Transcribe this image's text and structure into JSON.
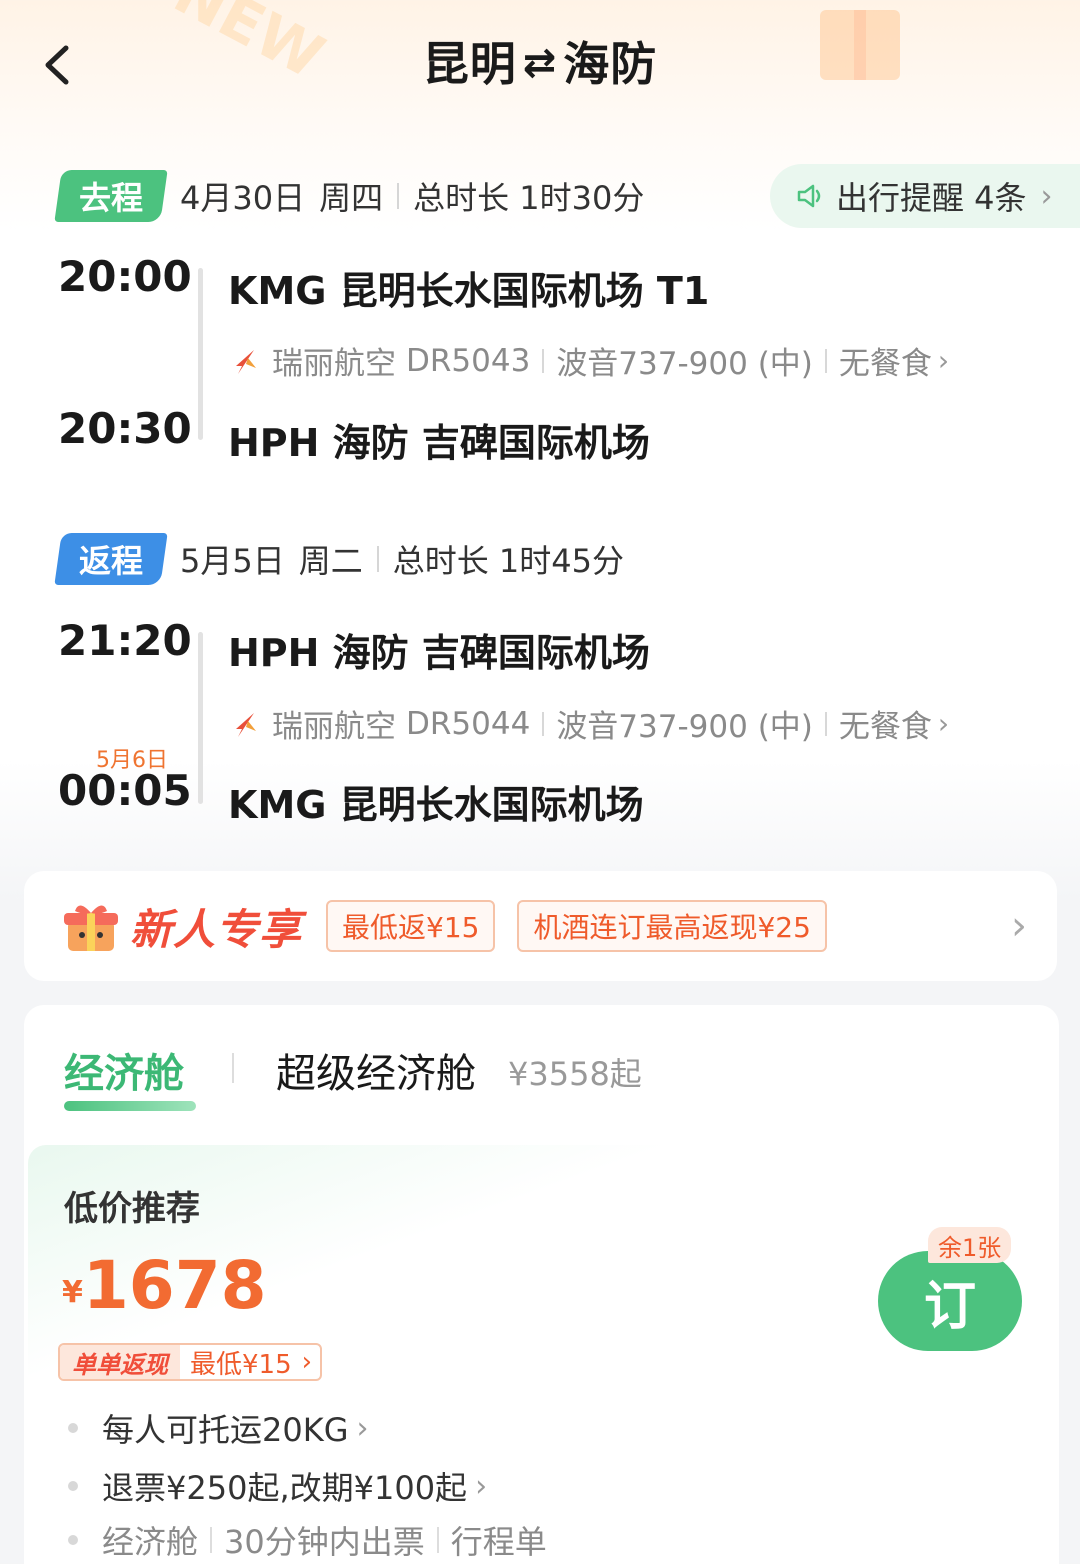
{
  "header": {
    "title_from": "昆明",
    "title_arrows": "⇄",
    "title_to": "海防"
  },
  "outbound": {
    "badge": "去程",
    "date": "4月30日",
    "weekday": "周四",
    "duration": "总时长 1时30分",
    "dep_time": "20:00",
    "dep_airport": "KMG 昆明长水国际机场 T1",
    "airline": "瑞丽航空",
    "flight_no": "DR5043",
    "aircraft": "波音737-900 (中)",
    "meal": "无餐食",
    "arr_time": "20:30",
    "arr_airport": "HPH 海防 吉碑国际机场"
  },
  "reminder": {
    "label": "出行提醒 4条"
  },
  "return": {
    "badge": "返程",
    "date": "5月5日",
    "weekday": "周二",
    "duration": "总时长 1时45分",
    "dep_time": "21:20",
    "dep_airport": "HPH 海防 吉碑国际机场",
    "airline": "瑞丽航空",
    "flight_no": "DR5044",
    "aircraft": "波音737-900 (中)",
    "meal": "无餐食",
    "arr_date_note": "5月6日",
    "arr_time": "00:05",
    "arr_airport": "KMG 昆明长水国际机场"
  },
  "promo": {
    "title": "新人专享",
    "coupon1": "最低返¥15",
    "coupon2": "机酒连订最高返现¥25"
  },
  "cabins": {
    "tab1": "经济舱",
    "tab2": "超级经济舱",
    "tab2_price": "¥3558起"
  },
  "fare": {
    "label": "低价推荐",
    "currency": "¥",
    "price": "1678",
    "cashback_tag": "单单返现",
    "cashback_value": "最低¥15",
    "book_label": "订",
    "remaining": "余1张",
    "rule1": "每人可托运20KG",
    "rule2": "退票¥250起,改期¥100起",
    "rule3a": "经济舱",
    "rule3b": "30分钟内出票",
    "rule3c": "行程单"
  },
  "colors": {
    "accent_green": "#4cc27f",
    "accent_blue": "#3d8fe6",
    "price_orange": "#f26b32"
  }
}
